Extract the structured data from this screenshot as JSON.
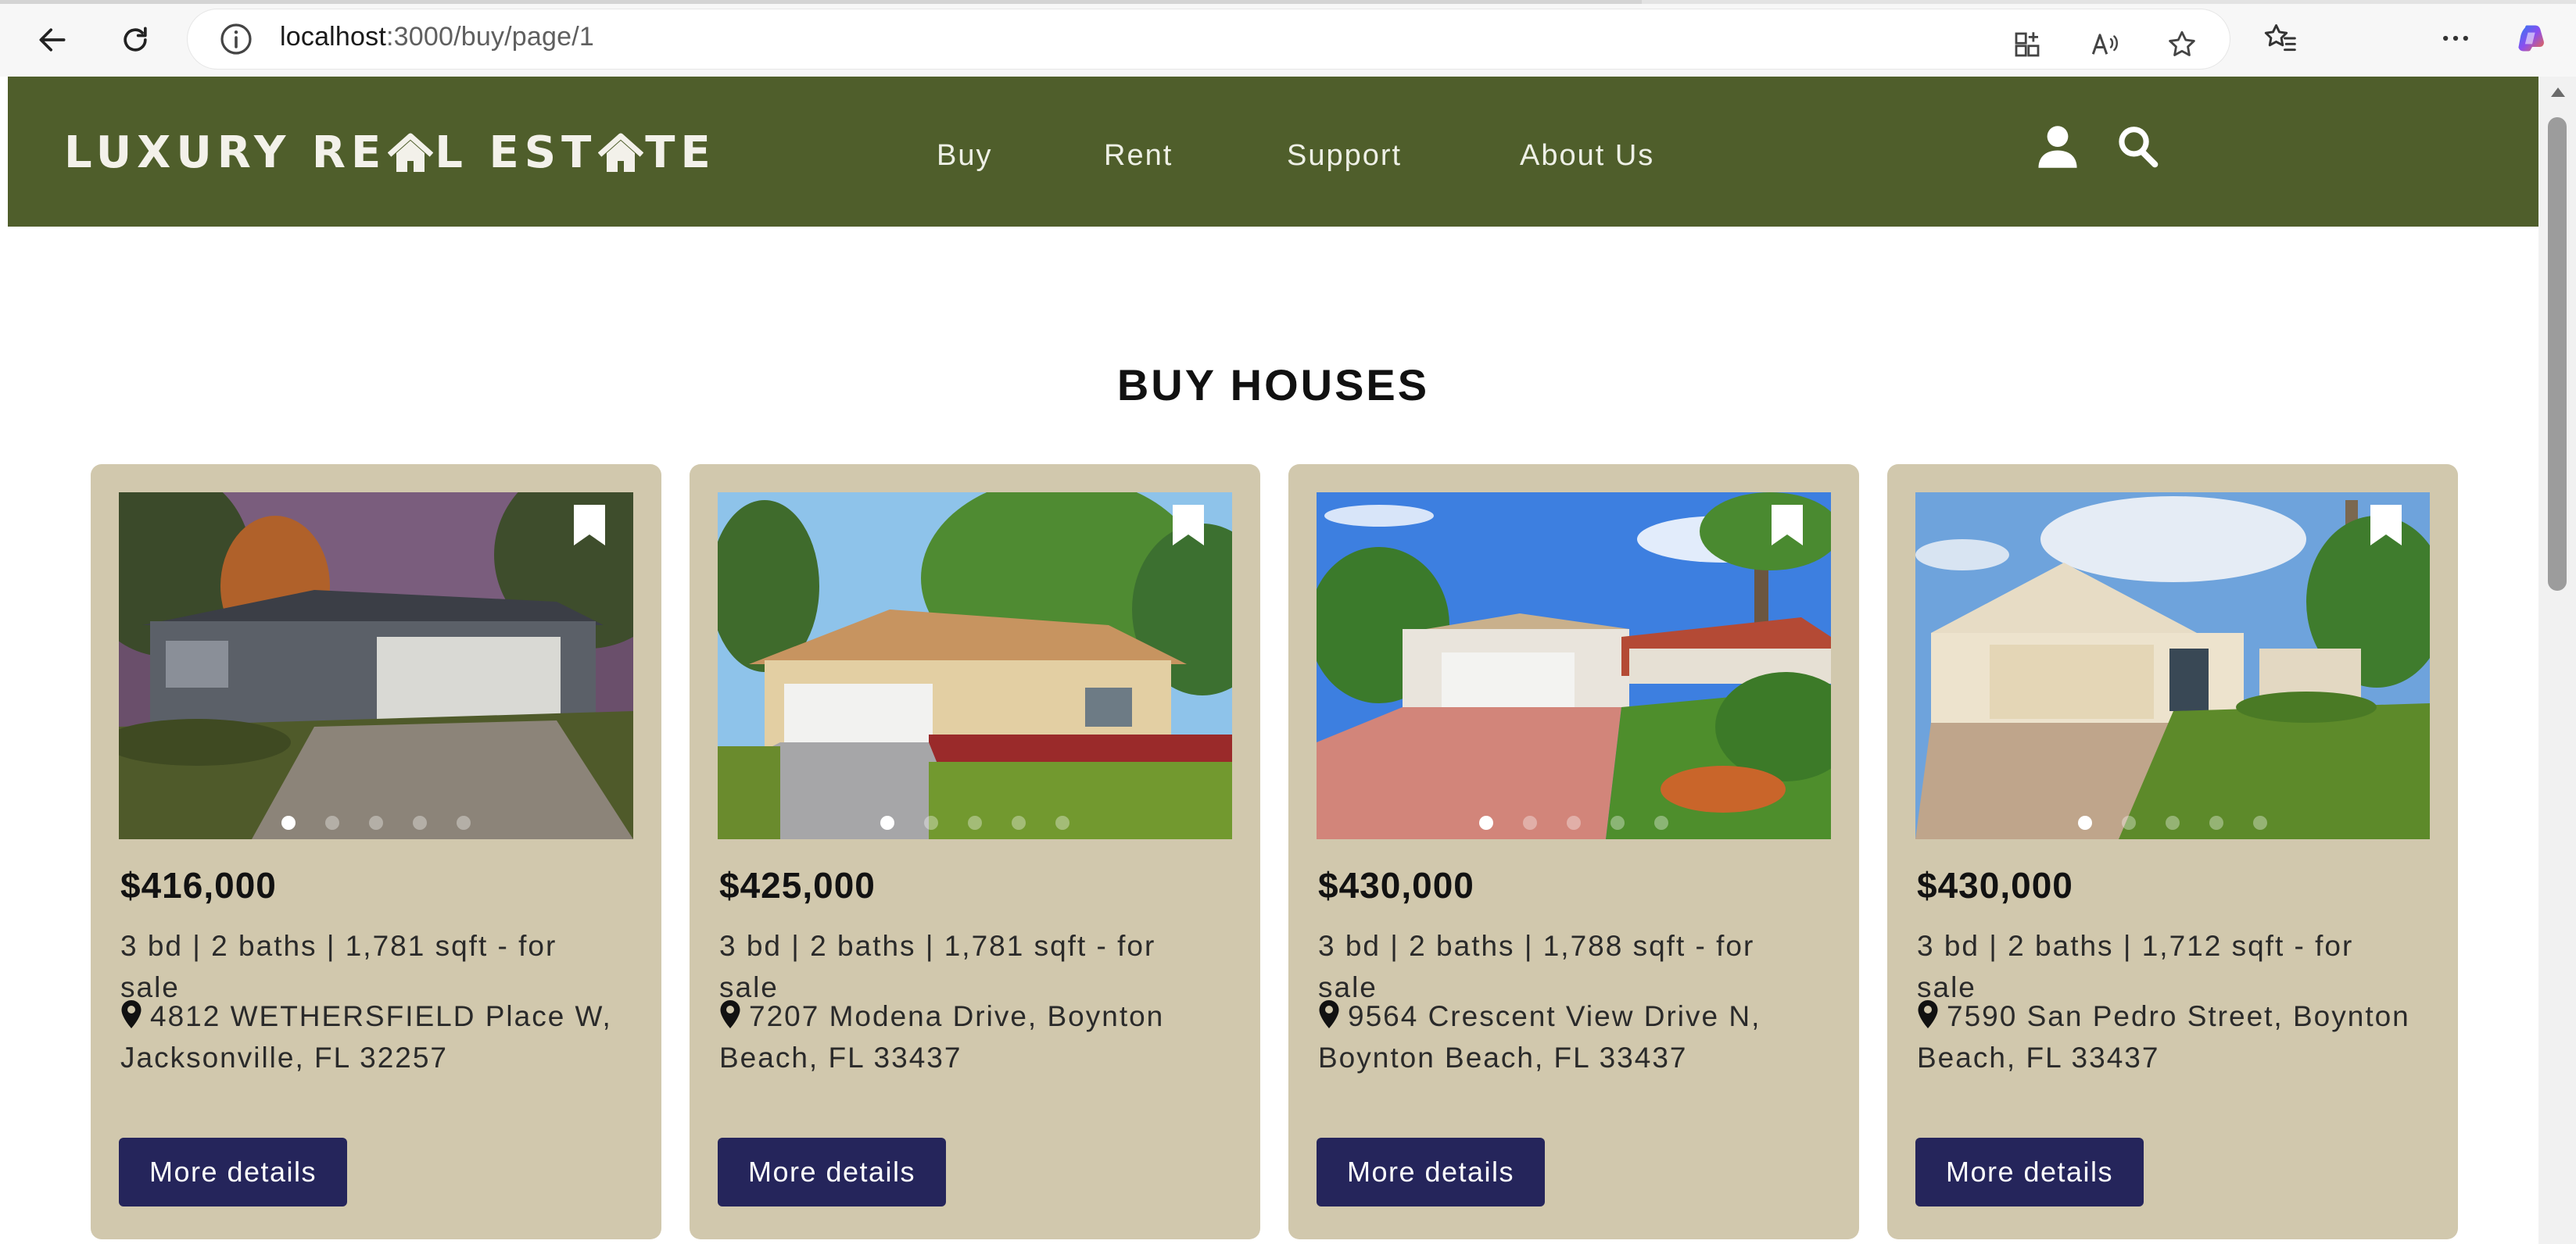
{
  "browser": {
    "url_host": "localhost",
    "url_path": ":3000/buy/page/1"
  },
  "site": {
    "logo_text_1": "LUXURY RE",
    "logo_text_2": "L EST",
    "logo_text_3": "TE",
    "nav": [
      "Buy",
      "Rent",
      "Support",
      "About Us"
    ]
  },
  "page": {
    "title": "BUY HOUSES"
  },
  "listings": [
    {
      "price": "$416,000",
      "specs": "3 bd | 2 baths | 1,781 sqft - for sale",
      "address": "4812 WETHERSFIELD Place W, Jacksonville, FL 32257",
      "button": "More details",
      "image_dots": 5,
      "active_dot": 1
    },
    {
      "price": "$425,000",
      "specs": "3 bd | 2 baths | 1,781 sqft - for sale",
      "address": "7207 Modena Drive, Boynton Beach, FL 33437",
      "button": "More details",
      "image_dots": 5,
      "active_dot": 1
    },
    {
      "price": "$430,000",
      "specs": "3 bd | 2 baths | 1,788 sqft - for sale",
      "address": "9564 Crescent View Drive N, Boynton Beach, FL 33437",
      "button": "More details",
      "image_dots": 5,
      "active_dot": 1
    },
    {
      "price": "$430,000",
      "specs": "3 bd | 2 baths | 1,712 sqft - for sale",
      "address": "7590 San Pedro Street, Boynton Beach, FL 33437",
      "button": "More details",
      "image_dots": 5,
      "active_dot": 1
    }
  ],
  "colors": {
    "header_bg": "#4f5e2b",
    "card_bg": "#d1c8ad",
    "button_bg": "#25255b"
  }
}
